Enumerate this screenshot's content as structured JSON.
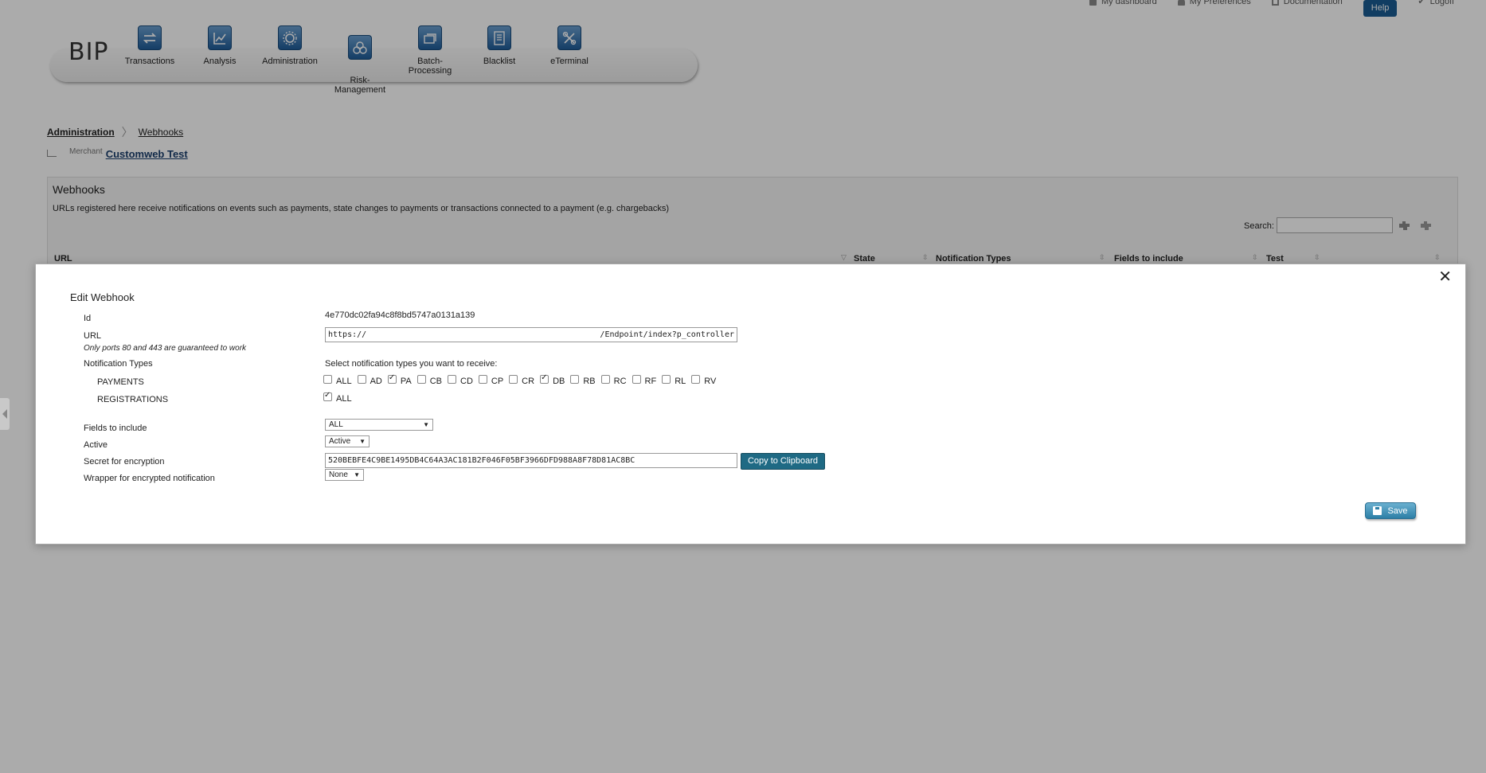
{
  "top_links": {
    "dashboard": "My dashboard",
    "preferences": "My Preferences",
    "documentation": "Documentation",
    "help": "Help",
    "logoff": "Logoff"
  },
  "logo": "BIP",
  "nav": {
    "transactions": "Transactions",
    "analysis": "Analysis",
    "administration": "Administration",
    "risk_management": "Risk-\nManagement",
    "batch_processing": "Batch-Processing",
    "blacklist": "Blacklist",
    "eterminal": "eTerminal"
  },
  "breadcrumb": {
    "first": "Administration",
    "second": "Webhooks"
  },
  "merchant": {
    "label": "Merchant",
    "name": "Customweb Test"
  },
  "panel": {
    "title": "Webhooks",
    "description": "URLs registered here receive notifications on events such as payments, state changes to payments or transactions connected to a payment (e.g. chargebacks)",
    "search_label": "Search:",
    "columns": {
      "url": "URL",
      "state": "State",
      "notification_types": "Notification Types",
      "fields_to_include": "Fields to include",
      "test": "Test"
    }
  },
  "modal": {
    "title": "Edit Webhook",
    "labels": {
      "id": "Id",
      "url": "URL",
      "url_hint": "Only ports 80 and 443 are guaranteed to work",
      "notification_types": "Notification Types",
      "payments": "PAYMENTS",
      "registrations": "REGISTRATIONS",
      "fields_to_include": "Fields to include",
      "active": "Active",
      "secret": "Secret for encryption",
      "wrapper": "Wrapper for encrypted notification"
    },
    "id_value": "4e770dc02fa94c8f8bd5747a0131a139",
    "url_value_start": "https://",
    "url_value_end": "/Endpoint/index?p_controller",
    "select_prompt": "Select notification types you want to receive:",
    "payment_types": [
      {
        "label": "ALL",
        "checked": false
      },
      {
        "label": "AD",
        "checked": false
      },
      {
        "label": "PA",
        "checked": true
      },
      {
        "label": "CB",
        "checked": false
      },
      {
        "label": "CD",
        "checked": false
      },
      {
        "label": "CP",
        "checked": false
      },
      {
        "label": "CR",
        "checked": false
      },
      {
        "label": "DB",
        "checked": true
      },
      {
        "label": "RB",
        "checked": false
      },
      {
        "label": "RC",
        "checked": false
      },
      {
        "label": "RF",
        "checked": false
      },
      {
        "label": "RL",
        "checked": false
      },
      {
        "label": "RV",
        "checked": false
      }
    ],
    "registration_types": [
      {
        "label": "ALL",
        "checked": true
      }
    ],
    "fields_select": "ALL",
    "active_select": "Active",
    "secret_value": "520BEBFE4C9BE1495DB4C64A3AC181B2F046F05BF3966DFD988A8F78D81AC8BC",
    "copy_button": "Copy to Clipboard",
    "wrapper_select": "None",
    "save_button": "Save"
  }
}
